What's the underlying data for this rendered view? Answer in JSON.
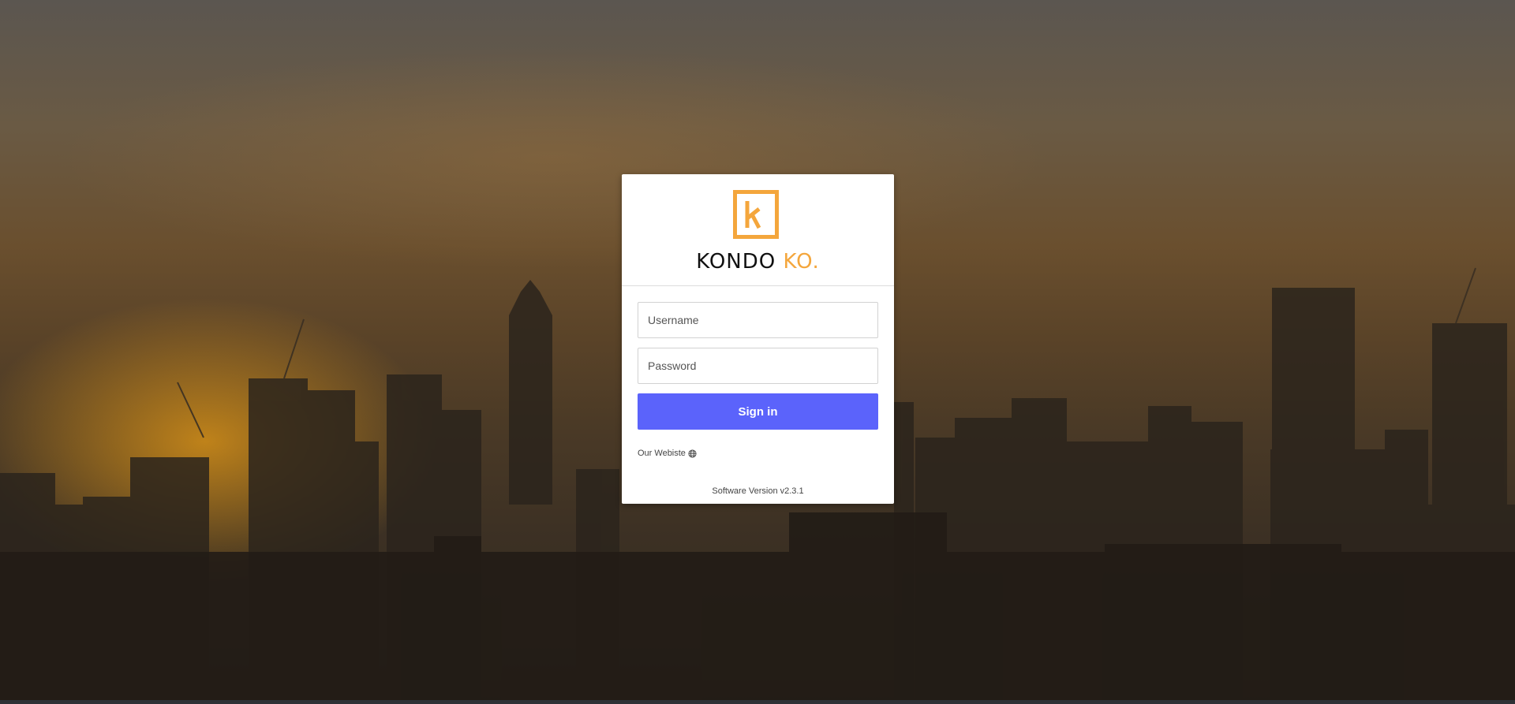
{
  "brand": {
    "name_part1": "KONDO",
    "name_part2": "KO.",
    "logo_icon": "k-square-logo-icon",
    "accent_color": "#f4a63c"
  },
  "login": {
    "username_placeholder": "Username",
    "password_placeholder": "Password",
    "signin_label": "Sign in",
    "signin_color": "#5b63fb",
    "website_label": "Our Webiste",
    "website_icon": "globe-icon",
    "version_text": "Software Version v2.3.1"
  }
}
